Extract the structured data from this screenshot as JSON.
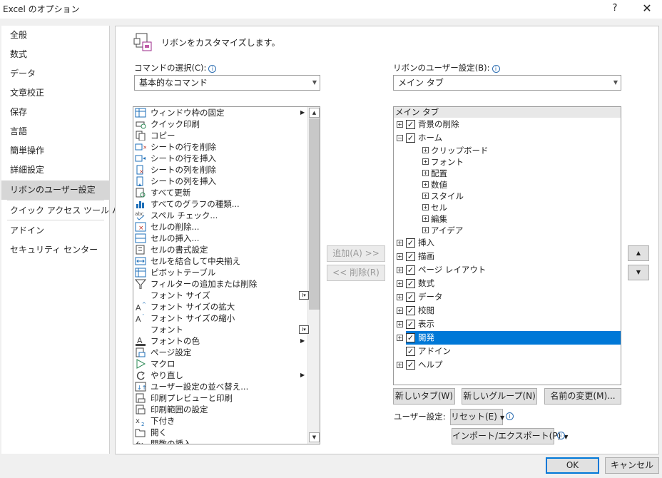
{
  "window": {
    "title": "Excel のオプション",
    "help": "?",
    "close": "✕"
  },
  "nav": {
    "items": [
      "全般",
      "数式",
      "データ",
      "文章校正",
      "保存",
      "言語",
      "簡単操作",
      "詳細設定",
      "リボンのユーザー設定",
      "クイック アクセス ツール バー",
      "アドイン",
      "セキュリティ センター"
    ],
    "selected": "リボンのユーザー設定"
  },
  "header": {
    "text": "リボンをカスタマイズします。"
  },
  "commands": {
    "label": "コマンドの選択(C):",
    "combo_value": "基本的なコマンド",
    "items": [
      {
        "label": "ウィンドウ枠の固定",
        "icon": "freeze-panes-icon",
        "extra": "arrow"
      },
      {
        "label": "クイック印刷",
        "icon": "quick-print-icon"
      },
      {
        "label": "コピー",
        "icon": "copy-icon"
      },
      {
        "label": "シートの行を削除",
        "icon": "delete-rows-icon"
      },
      {
        "label": "シートの行を挿入",
        "icon": "insert-rows-icon"
      },
      {
        "label": "シートの列を削除",
        "icon": "delete-columns-icon"
      },
      {
        "label": "シートの列を挿入",
        "icon": "insert-columns-icon"
      },
      {
        "label": "すべて更新",
        "icon": "refresh-all-icon"
      },
      {
        "label": "すべてのグラフの種類...",
        "icon": "all-charts-icon"
      },
      {
        "label": "スペル チェック...",
        "icon": "spelling-icon"
      },
      {
        "label": "セルの削除...",
        "icon": "delete-cells-icon"
      },
      {
        "label": "セルの挿入...",
        "icon": "insert-cells-icon"
      },
      {
        "label": "セルの書式設定",
        "icon": "format-cells-icon"
      },
      {
        "label": "セルを結合して中央揃え",
        "icon": "merge-center-icon"
      },
      {
        "label": "ピボットテーブル",
        "icon": "pivot-table-icon"
      },
      {
        "label": "フィルターの追加または削除",
        "icon": "filter-icon"
      },
      {
        "label": "フォント サイズ",
        "icon": "",
        "extra": "input"
      },
      {
        "label": "フォント サイズの拡大",
        "icon": "font-grow-icon"
      },
      {
        "label": "フォント サイズの縮小",
        "icon": "font-shrink-icon"
      },
      {
        "label": "フォント",
        "icon": "",
        "extra": "input"
      },
      {
        "label": "フォントの色",
        "icon": "font-color-icon",
        "extra": "arrow"
      },
      {
        "label": "ページ設定",
        "icon": "page-setup-icon"
      },
      {
        "label": "マクロ",
        "icon": "macro-icon"
      },
      {
        "label": "やり直し",
        "icon": "redo-icon",
        "extra": "arrow"
      },
      {
        "label": "ユーザー設定の並べ替え...",
        "icon": "custom-sort-icon"
      },
      {
        "label": "印刷プレビューと印刷",
        "icon": "print-preview-icon"
      },
      {
        "label": "印刷範囲の設定",
        "icon": "print-area-icon"
      },
      {
        "label": "下付き",
        "icon": "subscript-icon"
      },
      {
        "label": "開く",
        "icon": "open-icon"
      },
      {
        "label": "関数の挿入...",
        "icon": "insert-function-icon"
      }
    ]
  },
  "middle": {
    "add": "追加(A) >>",
    "remove": "<< 削除(R)"
  },
  "ribbon": {
    "label": "リボンのユーザー設定(B):",
    "combo_value": "メイン タブ",
    "tree_header": "メイン タブ",
    "tree": [
      {
        "label": "背景の削除",
        "level": 0,
        "plus": true,
        "check": true
      },
      {
        "label": "ホーム",
        "level": 0,
        "plus": true,
        "expanded": true,
        "check": true
      },
      {
        "label": "クリップボード",
        "level": 1,
        "plus": true,
        "check": false
      },
      {
        "label": "フォント",
        "level": 1,
        "plus": true,
        "check": false
      },
      {
        "label": "配置",
        "level": 1,
        "plus": true,
        "check": false
      },
      {
        "label": "数値",
        "level": 1,
        "plus": true,
        "check": false
      },
      {
        "label": "スタイル",
        "level": 1,
        "plus": true,
        "check": false
      },
      {
        "label": "セル",
        "level": 1,
        "plus": true,
        "check": false
      },
      {
        "label": "編集",
        "level": 1,
        "plus": true,
        "check": false
      },
      {
        "label": "アイデア",
        "level": 1,
        "plus": true,
        "check": false
      },
      {
        "label": "挿入",
        "level": 0,
        "plus": true,
        "check": true
      },
      {
        "label": "描画",
        "level": 0,
        "plus": true,
        "check": true
      },
      {
        "label": "ページ レイアウト",
        "level": 0,
        "plus": true,
        "check": true
      },
      {
        "label": "数式",
        "level": 0,
        "plus": true,
        "check": true
      },
      {
        "label": "データ",
        "level": 0,
        "plus": true,
        "check": true
      },
      {
        "label": "校閲",
        "level": 0,
        "plus": true,
        "check": true
      },
      {
        "label": "表示",
        "level": 0,
        "plus": true,
        "check": true
      },
      {
        "label": "開発",
        "level": 0,
        "plus": true,
        "check": true,
        "selected": true
      },
      {
        "label": "アドイン",
        "level": 0,
        "plus": false,
        "check": true
      },
      {
        "label": "ヘルプ",
        "level": 0,
        "plus": true,
        "check": true
      }
    ],
    "new_tab": "新しいタブ(W)",
    "new_group": "新しいグループ(N)",
    "rename": "名前の変更(M)...",
    "customizations_label": "ユーザー設定:",
    "reset": "リセット(E)",
    "import_export": "インポート/エクスポート(P)"
  },
  "footer": {
    "ok": "OK",
    "cancel": "キャンセル"
  },
  "colors": {
    "selection": "#0078d7",
    "info": "#2b6cb0"
  }
}
